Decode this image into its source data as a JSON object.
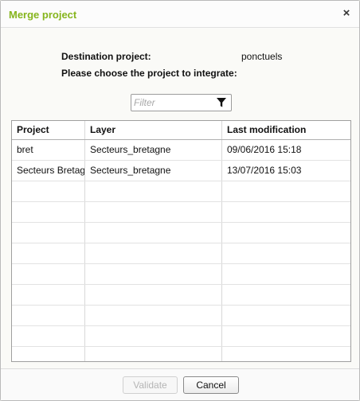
{
  "dialog": {
    "title": "Merge project",
    "close_glyph": "×"
  },
  "info": {
    "destination_label": "Destination project:",
    "destination_value": "ponctuels",
    "choose_label": "Please choose the project to integrate:"
  },
  "filter": {
    "placeholder": "Filter",
    "value": "",
    "icon": "funnel-icon"
  },
  "table": {
    "columns": [
      "Project",
      "Layer",
      "Last modification"
    ],
    "rows": [
      [
        "bret",
        "Secteurs_bretagne",
        "09/06/2016 15:18"
      ],
      [
        "Secteurs Bretagne",
        "Secteurs_bretagne",
        "13/07/2016 15:03"
      ],
      [
        "",
        "",
        ""
      ],
      [
        "",
        "",
        ""
      ],
      [
        "",
        "",
        ""
      ],
      [
        "",
        "",
        ""
      ],
      [
        "",
        "",
        ""
      ],
      [
        "",
        "",
        ""
      ],
      [
        "",
        "",
        ""
      ],
      [
        "",
        "",
        ""
      ],
      [
        "",
        "",
        ""
      ]
    ]
  },
  "buttons": {
    "validate_label": "Validate",
    "cancel_label": "Cancel"
  },
  "colors": {
    "title": "#86b51d"
  }
}
